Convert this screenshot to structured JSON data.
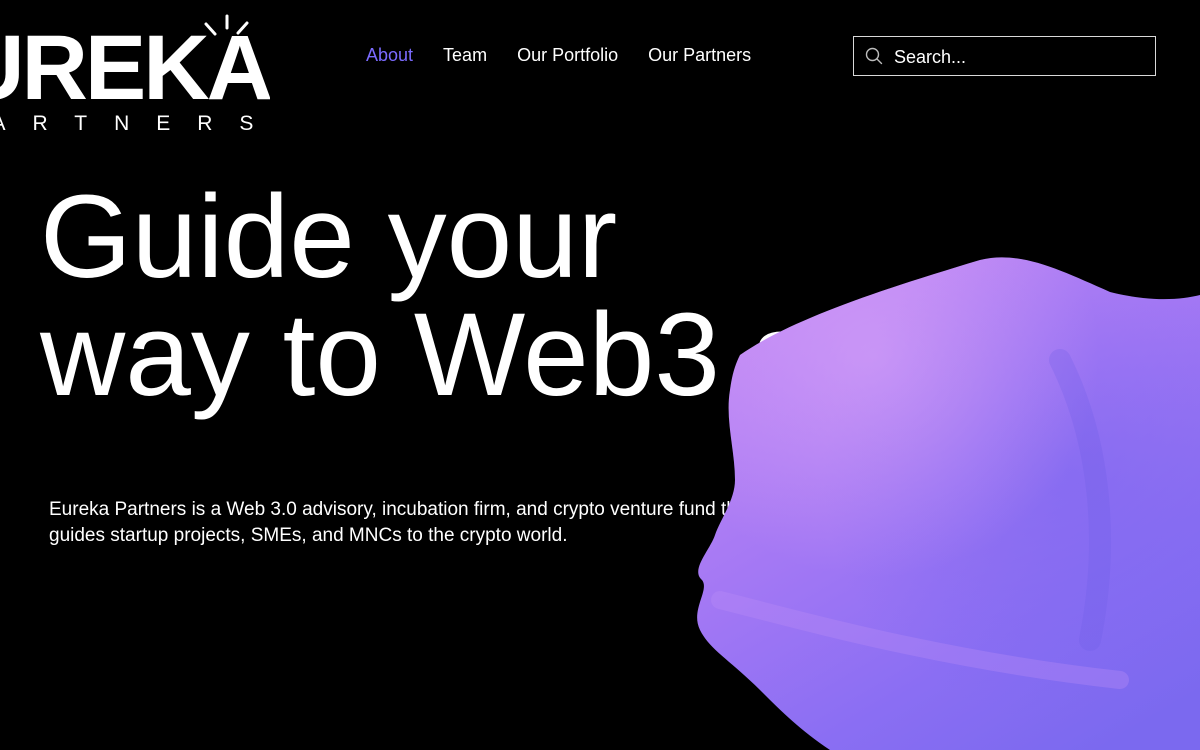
{
  "brand": {
    "logo_word": "UREKA",
    "logo_sub": "PARTNERS"
  },
  "nav": {
    "items": [
      {
        "label": "About",
        "active": true
      },
      {
        "label": "Team",
        "active": false
      },
      {
        "label": "Our Portfolio",
        "active": false
      },
      {
        "label": "Our Partners",
        "active": false
      }
    ]
  },
  "search": {
    "placeholder": "Search...",
    "icon": "search-icon"
  },
  "hero": {
    "title_line1": "Guide your",
    "title_line2": "way to Web3 s",
    "description": "Eureka Partners is a Web 3.0 advisory, incubation firm, and crypto venture fund that guides startup projects, SMEs, and MNCs to the crypto world."
  },
  "colors": {
    "background": "#000000",
    "text": "#ffffff",
    "accent": "#7b6bff",
    "blob_light": "#c48af5",
    "blob_dark": "#7f6cf2"
  }
}
